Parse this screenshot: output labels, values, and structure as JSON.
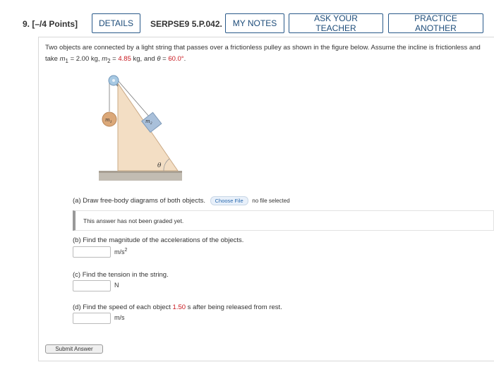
{
  "header": {
    "question_number": "9.",
    "points": "[–/4 Points]",
    "details_label": "DETAILS",
    "question_id": "SERPSE9 5.P.042.",
    "my_notes_label": "MY NOTES",
    "ask_teacher_label": "ASK YOUR TEACHER",
    "practice_label": "PRACTICE ANOTHER"
  },
  "problem": {
    "text_1": "Two objects are connected by a light string that passes over a frictionless pulley as shown in the figure below. Assume the incline is frictionless and take ",
    "m1_symbol": "m",
    "m1_sub": "1",
    "m1_value": " = 2.00 kg, ",
    "m2_symbol": "m",
    "m2_sub": "2",
    "m2_eq": " = ",
    "m2_value": "4.85",
    "m2_unit": " kg, and ",
    "theta_symbol": "θ",
    "theta_eq": " = ",
    "theta_value": "60.0°",
    "end": "."
  },
  "figure": {
    "m1_label": "m",
    "m1_sub": "1",
    "m2_label": "m",
    "m2_sub": "2",
    "angle_label": "θ",
    "colors": {
      "wedge": "#f2dcc0",
      "wedge_stroke": "#c9a882",
      "block": "#a9bfd8",
      "ball": "#d8a373",
      "ground": "#b9b3a8",
      "pulley": "#9fc4e0"
    }
  },
  "part_a": {
    "question": "(a) Draw free-body diagrams of both objects.",
    "choose_file_label": "Choose File",
    "no_file_label": "no file selected",
    "graded_message": "This answer has not been graded yet."
  },
  "part_b": {
    "question": "(b) Find the magnitude of the accelerations of the objects.",
    "unit": "m/s",
    "unit_sup": "2",
    "value": ""
  },
  "part_c": {
    "question": "(c) Find the tension in the string.",
    "unit": "N",
    "value": ""
  },
  "part_d": {
    "question_1": "(d) Find the speed of each object ",
    "time_value": "1.50",
    "question_2": " s after being released from rest.",
    "unit": "m/s",
    "value": ""
  },
  "submit_label": "Submit Answer"
}
